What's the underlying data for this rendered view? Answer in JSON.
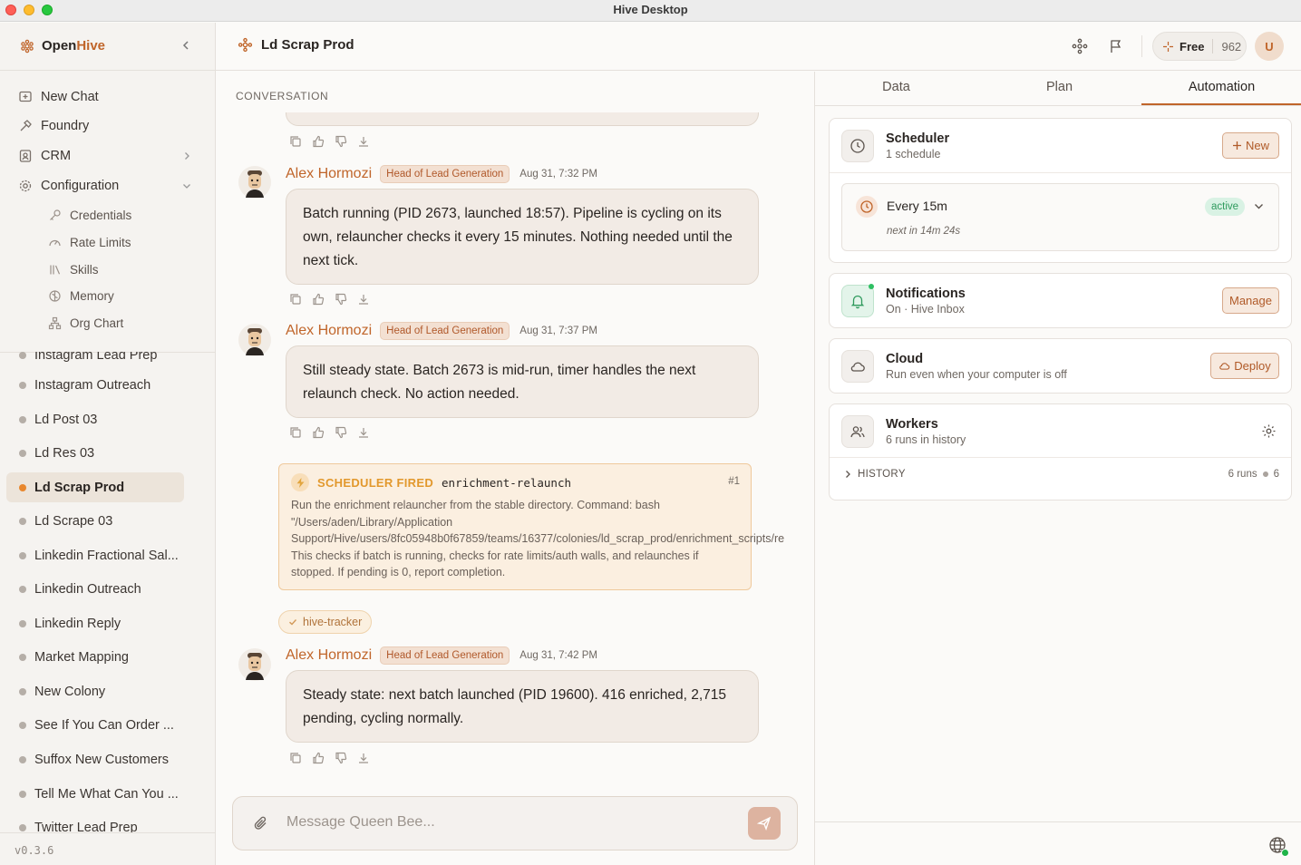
{
  "window": {
    "title": "Hive Desktop"
  },
  "sidebar": {
    "brand_open": "Open",
    "brand_hive": "Hive",
    "nav": [
      {
        "label": "New Chat",
        "icon": "new-chat-icon"
      },
      {
        "label": "Foundry",
        "icon": "hammer-icon"
      },
      {
        "label": "CRM",
        "icon": "contacts-icon"
      },
      {
        "label": "Configuration",
        "icon": "gear-icon"
      }
    ],
    "config_items": [
      {
        "label": "Credentials",
        "icon": "key-icon"
      },
      {
        "label": "Rate Limits",
        "icon": "gauge-icon"
      },
      {
        "label": "Skills",
        "icon": "library-icon"
      },
      {
        "label": "Memory",
        "icon": "brain-icon"
      },
      {
        "label": "Org Chart",
        "icon": "org-chart-icon"
      }
    ],
    "colonies": [
      {
        "label": "Instagram Lead Prep"
      },
      {
        "label": "Instagram Outreach"
      },
      {
        "label": "Ld Post 03"
      },
      {
        "label": "Ld Res 03"
      },
      {
        "label": "Ld Scrap Prod",
        "active": true
      },
      {
        "label": "Ld Scrape 03"
      },
      {
        "label": "Linkedin Fractional Sal..."
      },
      {
        "label": "Linkedin Outreach"
      },
      {
        "label": "Linkedin Reply"
      },
      {
        "label": "Market Mapping"
      },
      {
        "label": "New Colony"
      },
      {
        "label": "See If You Can Order ..."
      },
      {
        "label": "Suffox New Customers"
      },
      {
        "label": "Tell Me What Can You ..."
      },
      {
        "label": "Twitter Lead Prep"
      }
    ],
    "version": "v0.3.6"
  },
  "header": {
    "title": "Ld Scrap Prod",
    "plan": "Free",
    "credits": "962",
    "avatar": "U"
  },
  "conversation": {
    "label": "CONVERSATION",
    "messages": [
      {
        "sender": "Alex Hormozi",
        "role": "Head of Lead Generation",
        "time": "Aug 31, 7:32 PM",
        "text": "Batch running (PID 2673, launched 18:57). Pipeline is cycling on its own, relauncher checks it every 15 minutes. Nothing needed until the next tick."
      },
      {
        "sender": "Alex Hormozi",
        "role": "Head of Lead Generation",
        "time": "Aug 31, 7:37 PM",
        "text": "Still steady state. Batch 2673 is mid-run, timer handles the next relaunch check. No action needed."
      },
      {
        "sender": "Alex Hormozi",
        "role": "Head of Lead Generation",
        "time": "Aug 31, 7:42 PM",
        "text": "Steady state: next batch launched (PID 19600). 416 enriched, 2,715 pending, cycling normally."
      }
    ],
    "scheduler_event": {
      "label": "SCHEDULER FIRED",
      "task": "enrichment-relaunch",
      "number": "#1",
      "body": "Run the enrichment relauncher from the stable directory. Command: bash\n\"/Users/aden/Library/Application\nSupport/Hive/users/8fc05948b0f67859/teams/16377/colonies/ld_scrap_prod/enrichment_scripts/re\nThis checks if batch is running, checks for rate limits/auth walls, and relaunches if\nstopped. If pending is 0, report completion."
    },
    "tracker_tag": "hive-tracker",
    "composer_placeholder": "Message Queen Bee..."
  },
  "right_panel": {
    "tabs": [
      "Data",
      "Plan",
      "Automation"
    ],
    "active_tab": "Automation",
    "scheduler": {
      "title": "Scheduler",
      "subtitle": "1 schedule",
      "new_label": "New",
      "schedule_name": "Every 15m",
      "status": "active",
      "next_run": "next in 14m 24s"
    },
    "notifications": {
      "title": "Notifications",
      "subtitle": "On · Hive Inbox",
      "button": "Manage"
    },
    "cloud": {
      "title": "Cloud",
      "subtitle": "Run even when your computer is off",
      "button": "Deploy"
    },
    "workers": {
      "title": "Workers",
      "subtitle": "6 runs in history",
      "history_label": "HISTORY",
      "runs_label": "6 runs",
      "runs_count": "6"
    }
  },
  "colors": {
    "accent": "#c0652a",
    "active_dot": "#e8872d",
    "status_green": "#2f9a5d"
  }
}
